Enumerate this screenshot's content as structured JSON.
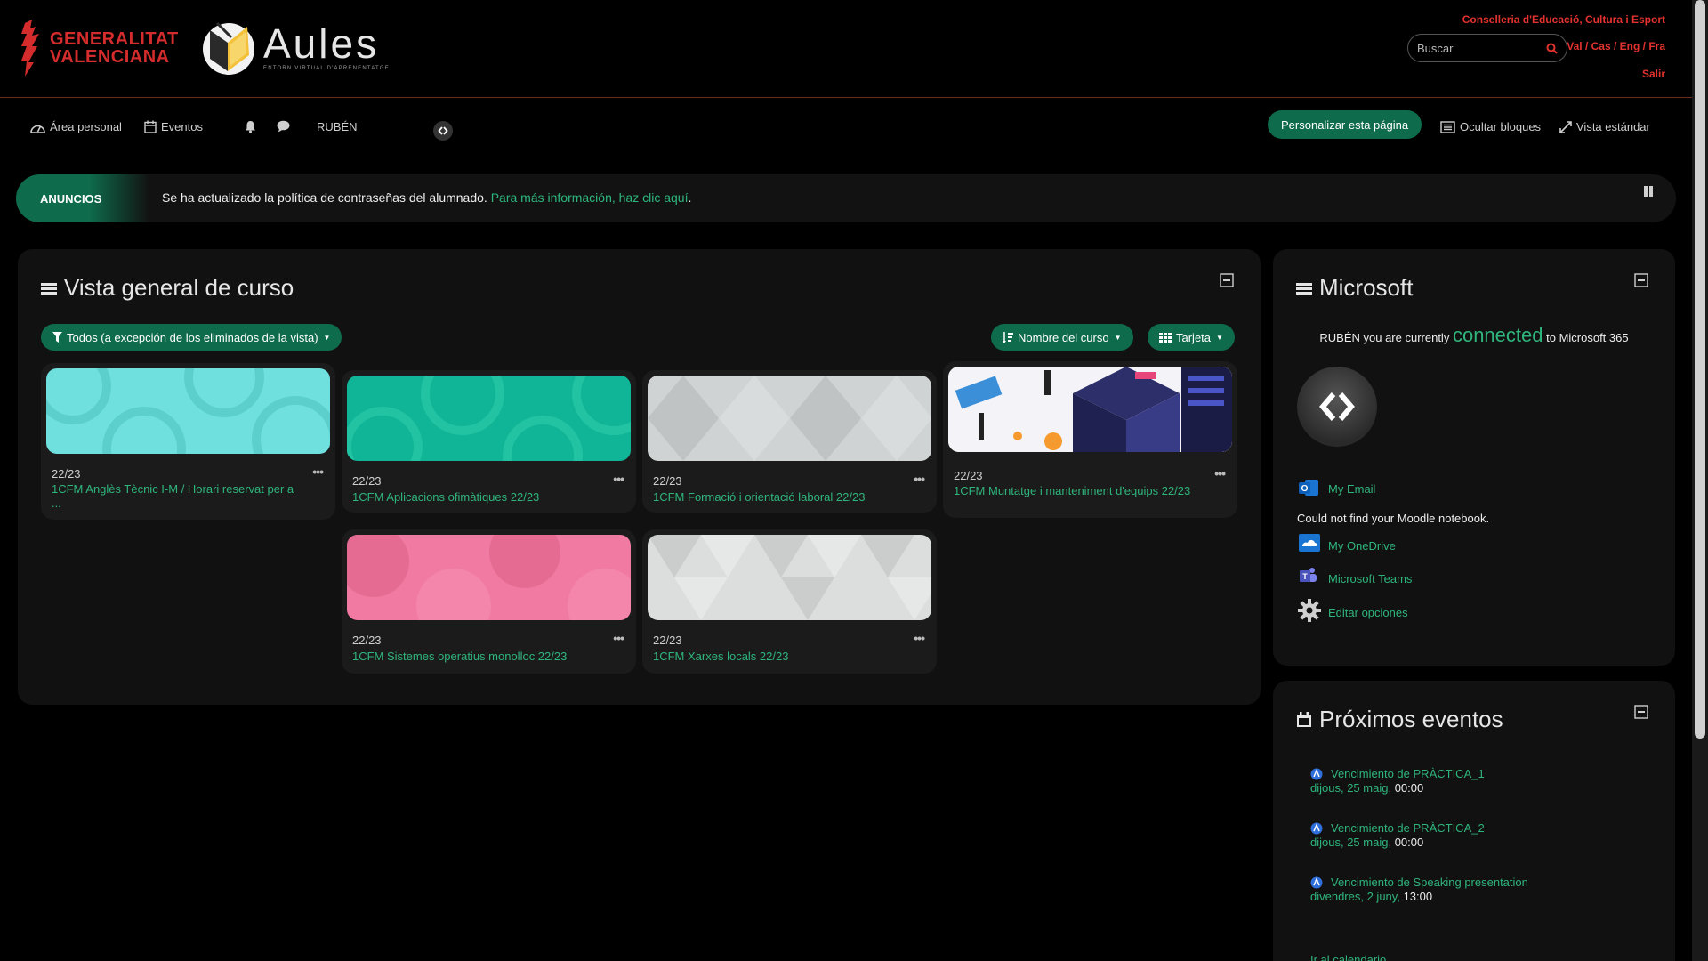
{
  "header": {
    "gva_line1": "GENERALITAT",
    "gva_line2": "VALENCIANA",
    "aules_title": "Aules",
    "aules_subtitle": "ENTORN VIRTUAL D'APRENENTATGE",
    "conselleria": "Conselleria d'Educació, Cultura i Esport",
    "search_placeholder": "Buscar",
    "languages": "Val / Cas / Eng / Fra",
    "logout": "Salir"
  },
  "navbar": {
    "area_personal": "Área personal",
    "eventos": "Eventos",
    "user": "RUBÉN",
    "personalize": "Personalizar esta página",
    "hide_blocks": "Ocultar bloques",
    "standard_view": "Vista estándar"
  },
  "announcement": {
    "tag": "ANUNCIOS",
    "text": "Se ha actualizado la política de contraseñas del alumnado.",
    "link": "Para más información, haz clic aquí",
    "end": "."
  },
  "course_overview": {
    "title": "Vista general de curso",
    "filter": "Todos (a excepción de los eliminados de la vista)",
    "sort": "Nombre del curso",
    "view": "Tarjeta",
    "courses": [
      {
        "term": "22/23",
        "name": "1CFM Anglès Tècnic I-M / Horari reservat per a ..."
      },
      {
        "term": "22/23",
        "name": "1CFM Aplicacions ofimàtiques 22/23"
      },
      {
        "term": "22/23",
        "name": "1CFM Formació i orientació laboral 22/23"
      },
      {
        "term": "22/23",
        "name": "1CFM Muntatge i manteniment d'equips 22/23"
      },
      {
        "term": "22/23",
        "name": "1CFM Sistemes operatius monolloc 22/23"
      },
      {
        "term": "22/23",
        "name": "1CFM Xarxes locals 22/23"
      }
    ]
  },
  "microsoft": {
    "title": "Microsoft",
    "status_pre": "RUBÉN you are currently",
    "status_word": "connected",
    "status_post": "to Microsoft 365",
    "email": "My Email",
    "notebook_msg": "Could not find your Moodle notebook.",
    "onedrive": "My OneDrive",
    "teams": "Microsoft Teams",
    "edit": "Editar opciones"
  },
  "events": {
    "title": "Próximos eventos",
    "items": [
      {
        "name": "Vencimiento de PRÀCTICA_1",
        "date": "dijous, 25 maig",
        "time": "00:00"
      },
      {
        "name": "Vencimiento de PRÀCTICA_2",
        "date": "dijous, 25 maig",
        "time": "00:00"
      },
      {
        "name": "Vencimiento de Speaking presentation",
        "date": "divendres, 2 juny",
        "time": "13:00"
      }
    ],
    "calendar_link": "Ir al calendario"
  },
  "colors": {
    "accent": "#0e6b4b",
    "link": "#2fb57c",
    "brand_red": "#e2322e"
  }
}
